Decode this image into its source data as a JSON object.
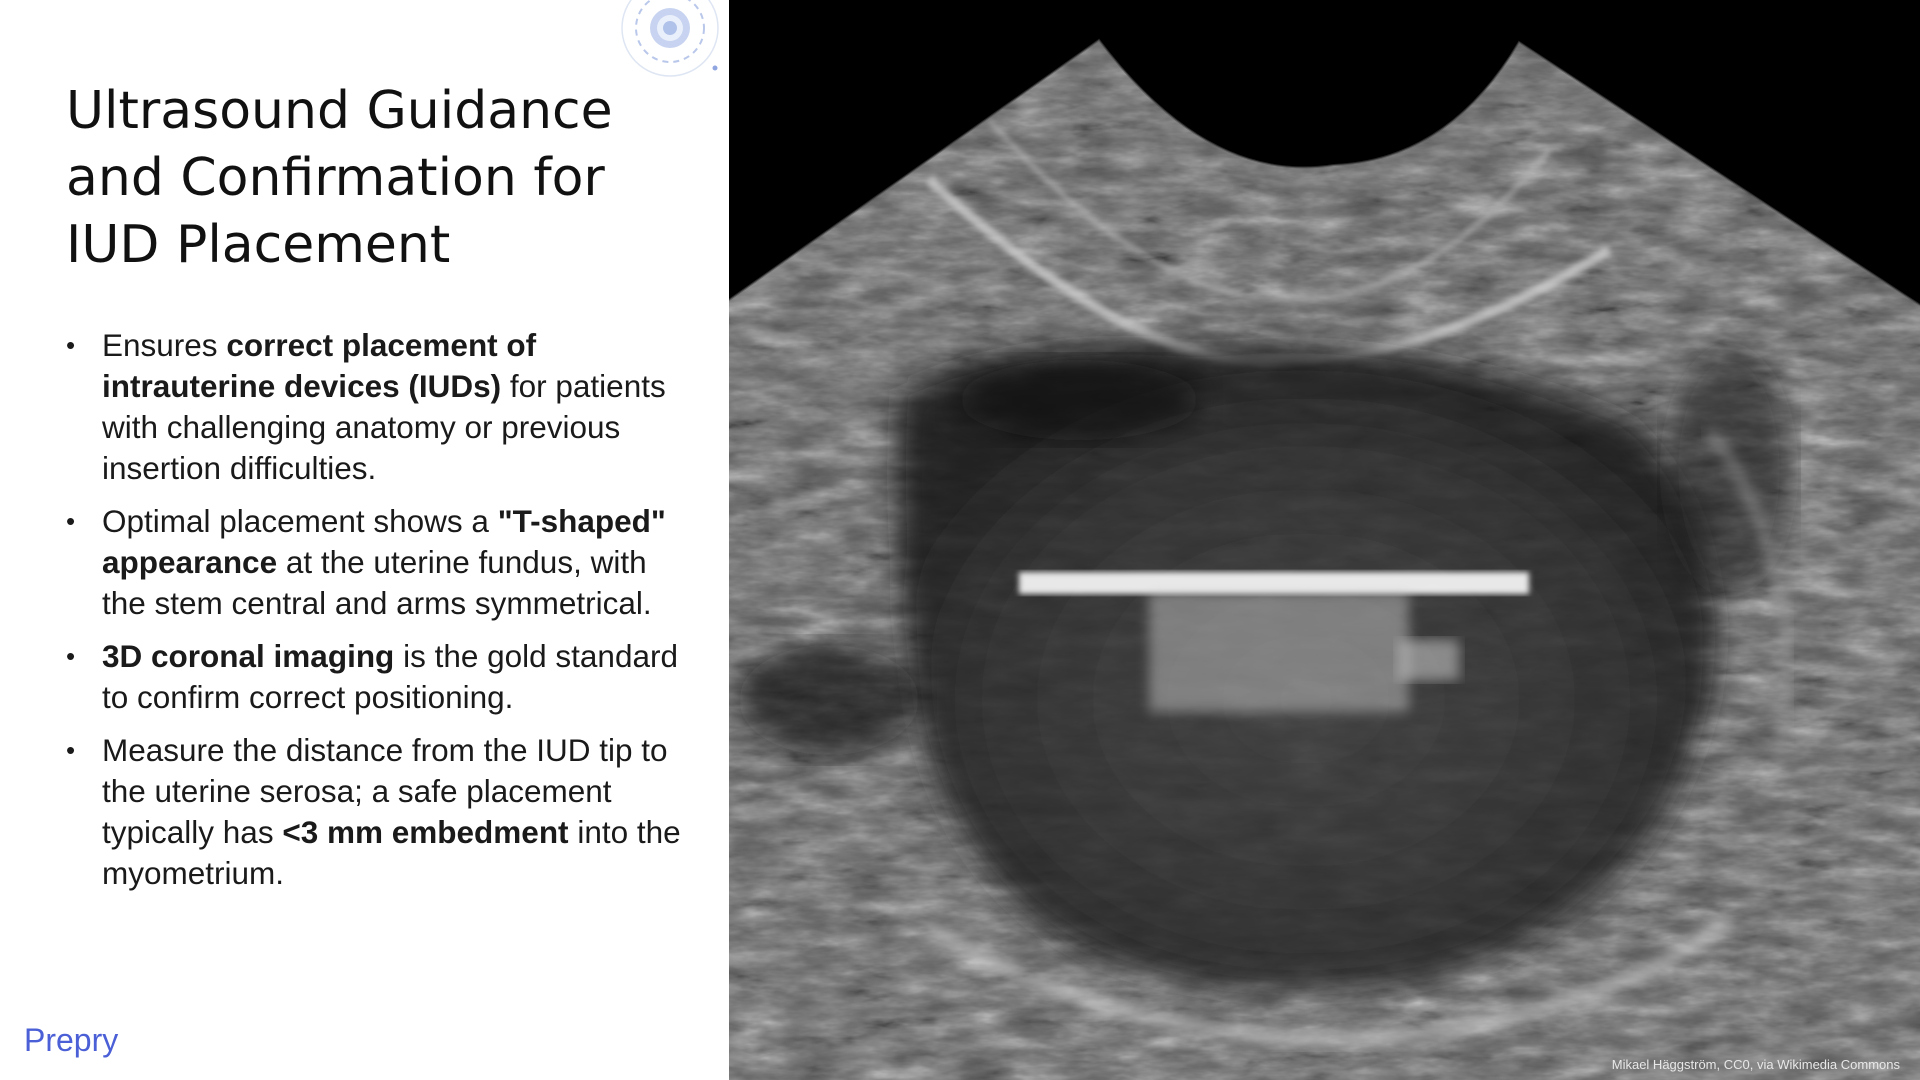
{
  "slide": {
    "title_lines": [
      "Ultrasound Guidance",
      "and Confirmation for",
      "IUD Placement"
    ],
    "bullets": [
      {
        "parts": [
          {
            "text": "Ensures ",
            "bold": false
          },
          {
            "text": "correct placement of intrauterine devices (IUDs)",
            "bold": true
          },
          {
            "text": " for patients with challenging anatomy or previous insertion difficulties.",
            "bold": false
          }
        ]
      },
      {
        "parts": [
          {
            "text": "Optimal placement shows a ",
            "bold": false
          },
          {
            "text": "\"T-shaped\" appearance",
            "bold": true
          },
          {
            "text": " at the uterine fundus, with the stem central and arms symmetrical.",
            "bold": false
          }
        ]
      },
      {
        "parts": [
          {
            "text": "3D coronal imaging",
            "bold": true
          },
          {
            "text": " is the gold standard to confirm correct positioning.",
            "bold": false
          }
        ]
      },
      {
        "parts": [
          {
            "text": "Measure the distance from the IUD tip to the uterine serosa; a safe placement typically has ",
            "bold": false
          },
          {
            "text": "<3 mm embedment",
            "bold": true
          },
          {
            "text": " into the myometrium.",
            "bold": false
          }
        ]
      }
    ],
    "brand": "Prepry",
    "image_credit": "Mikael Häggström, CC0, via Wikimedia Commons"
  },
  "colors": {
    "brand": "#4b5fd6",
    "title": "#111111",
    "body": "#1a1a1a",
    "image_bg": "#000000"
  },
  "icons": [
    "logo-ring-icon"
  ]
}
